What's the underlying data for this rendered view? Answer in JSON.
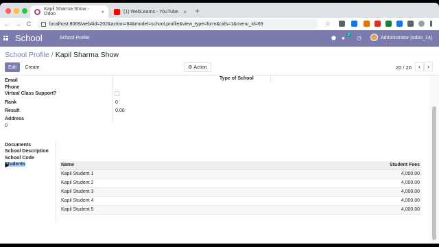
{
  "browser": {
    "tabs": [
      {
        "title": "Kapil Sharma Show - Odoo",
        "close": "×"
      },
      {
        "title": "(1) WebLearns - YouTube",
        "close": "×"
      }
    ],
    "new_tab": "+",
    "url": "localhost:8069/web#id=202&action=84&model=school.profile&view_type=form&cids=1&menu_id=69",
    "nav": {
      "back": "←",
      "forward": "→",
      "reload": "C"
    },
    "star": "☆"
  },
  "odoo_nav": {
    "app_name": "School",
    "menu": "School Profile",
    "chat_badge": "2",
    "user": "Administrator (odoo_14)",
    "color": "#7c7bad"
  },
  "breadcrumb": {
    "parent": "School Profile",
    "separator": "/",
    "current": "Kapil Sharma Show"
  },
  "buttons": {
    "edit": "Edit",
    "create": "Create",
    "action": "Action",
    "action_icon": "⚙"
  },
  "pager": {
    "text": "20 / 20",
    "prev": "‹",
    "next": "›"
  },
  "form": {
    "email_label": "Email",
    "phone_label": "Phone",
    "virtual_class_label": "Virtual Class Support?",
    "rank_label": "Rank",
    "rank_value": "0",
    "result_label": "Result",
    "result_value": "0.00",
    "address_label": "Address",
    "address_value": "0",
    "type_of_school_label": "Type of School"
  },
  "notebook": {
    "tabs": [
      "Documents",
      "School Description",
      "School Code",
      "Students"
    ]
  },
  "students_table": {
    "headers": {
      "name": "Name",
      "fees": "Student Fees"
    },
    "rows": [
      {
        "name": "Kapil Student 1",
        "fees": "4,000.00"
      },
      {
        "name": "Kapil Student 2",
        "fees": "4,000.00"
      },
      {
        "name": "Kapil Student 3",
        "fees": "4,000.00"
      },
      {
        "name": "Kapil Student 4",
        "fees": "4,000.00"
      },
      {
        "name": "Kapil Student 5",
        "fees": "4,000.00"
      }
    ]
  }
}
